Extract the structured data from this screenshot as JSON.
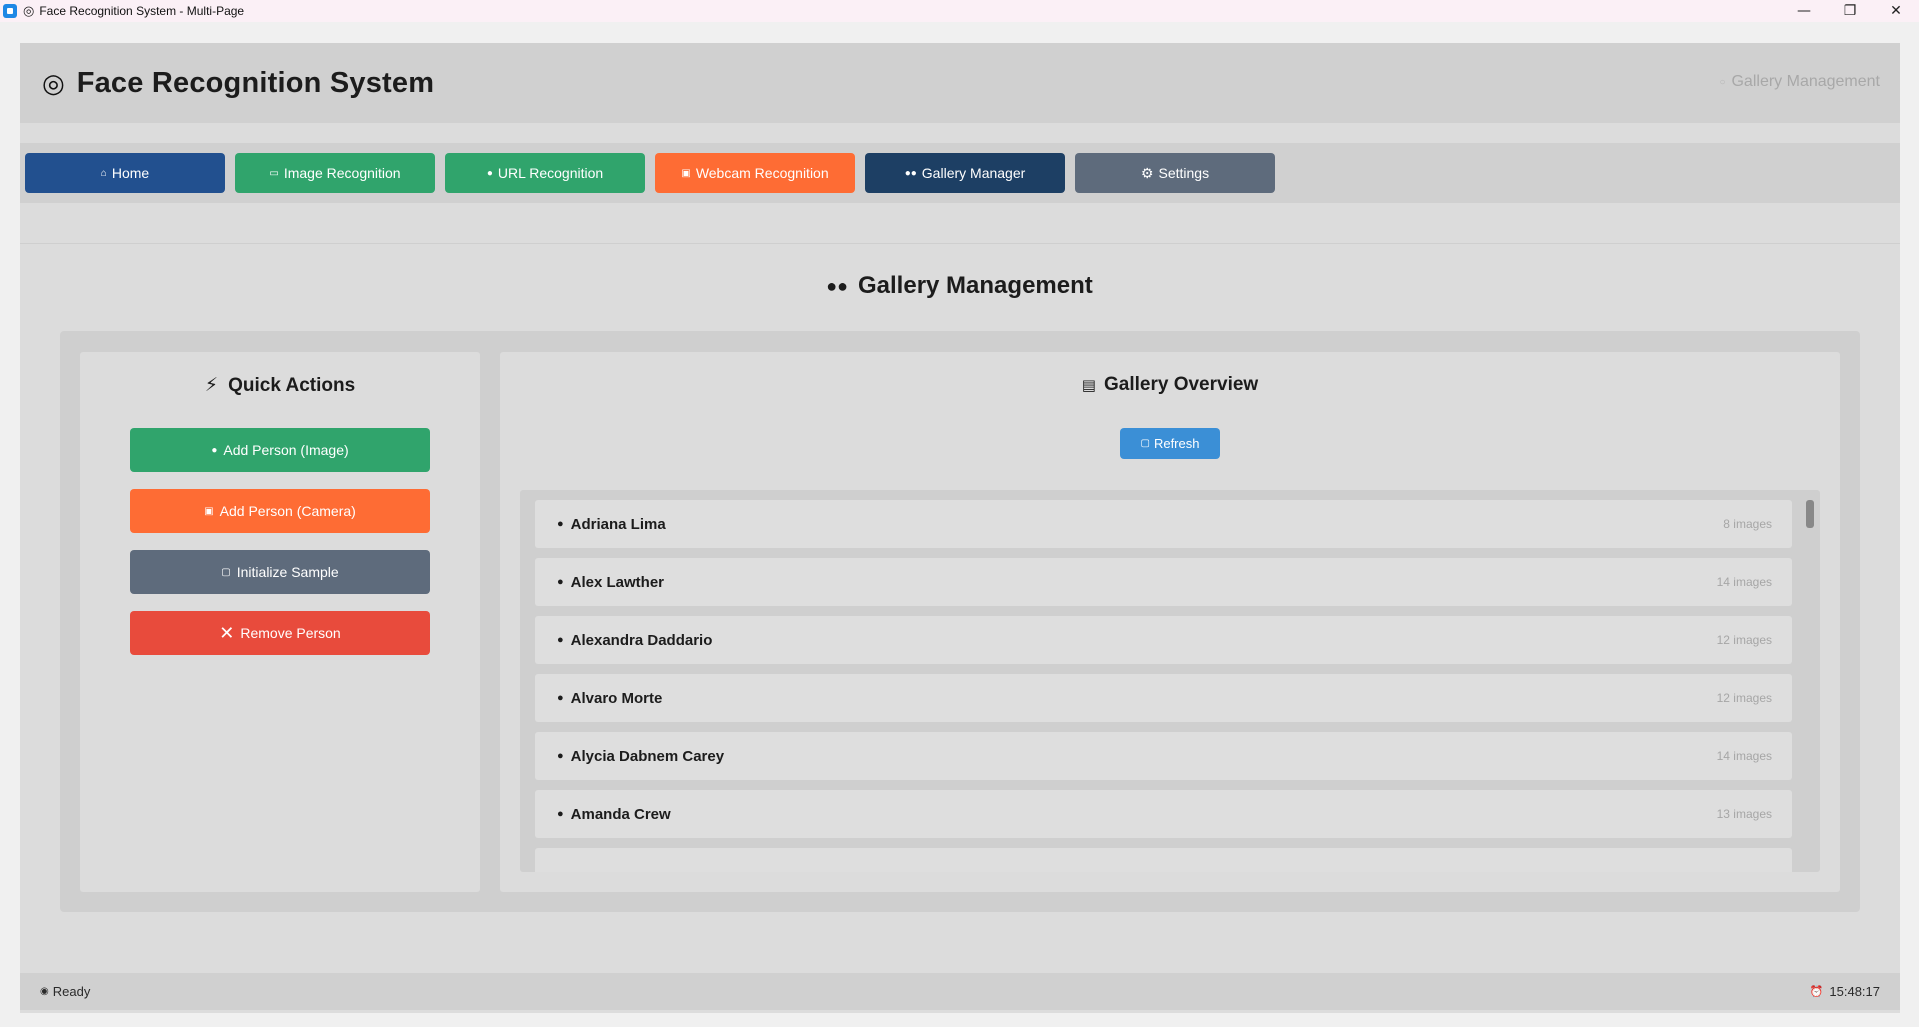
{
  "window": {
    "title": "Face Recognition System - Multi-Page",
    "controls": {
      "minimize": "—",
      "restore": "❐",
      "close": "✕"
    }
  },
  "header": {
    "title": "Face Recognition System",
    "logo_icon": "target-icon",
    "context": "Gallery Management"
  },
  "nav": [
    {
      "label": "Home",
      "icon": "house-icon",
      "color": "#22508f"
    },
    {
      "label": "Image Recognition",
      "icon": "image-icon",
      "color": "#30a46c"
    },
    {
      "label": "URL Recognition",
      "icon": "globe-icon",
      "color": "#30a46c"
    },
    {
      "label": "Webcam Recognition",
      "icon": "camera-icon",
      "color": "#fe6c34"
    },
    {
      "label": "Gallery Manager",
      "icon": "users-icon",
      "color": "#1d3f64",
      "active": true
    },
    {
      "label": "Settings",
      "icon": "gear-icon",
      "color": "#5e6b7c"
    }
  ],
  "page": {
    "heading": "Gallery Management"
  },
  "quick_actions": {
    "title": "Quick Actions",
    "buttons": [
      {
        "label": "Add Person (Image)",
        "icon": "person-icon",
        "color": "#30a46c"
      },
      {
        "label": "Add Person (Camera)",
        "icon": "camera-icon",
        "color": "#fe6c34"
      },
      {
        "label": "Initialize Sample",
        "icon": "refresh-icon",
        "color": "#5e6b7c"
      },
      {
        "label": "Remove Person",
        "icon": "close-icon",
        "color": "#e84b3c"
      }
    ]
  },
  "gallery_overview": {
    "title": "Gallery Overview",
    "refresh_label": "Refresh",
    "people": [
      {
        "name": "Adriana Lima",
        "count": "8 images"
      },
      {
        "name": "Alex Lawther",
        "count": "14 images"
      },
      {
        "name": "Alexandra Daddario",
        "count": "12 images"
      },
      {
        "name": "Alvaro Morte",
        "count": "12 images"
      },
      {
        "name": "Alycia Dabnem Carey",
        "count": "14 images"
      },
      {
        "name": "Amanda Crew",
        "count": "13 images"
      }
    ]
  },
  "status": {
    "left": "Ready",
    "right": "15:48:17"
  }
}
